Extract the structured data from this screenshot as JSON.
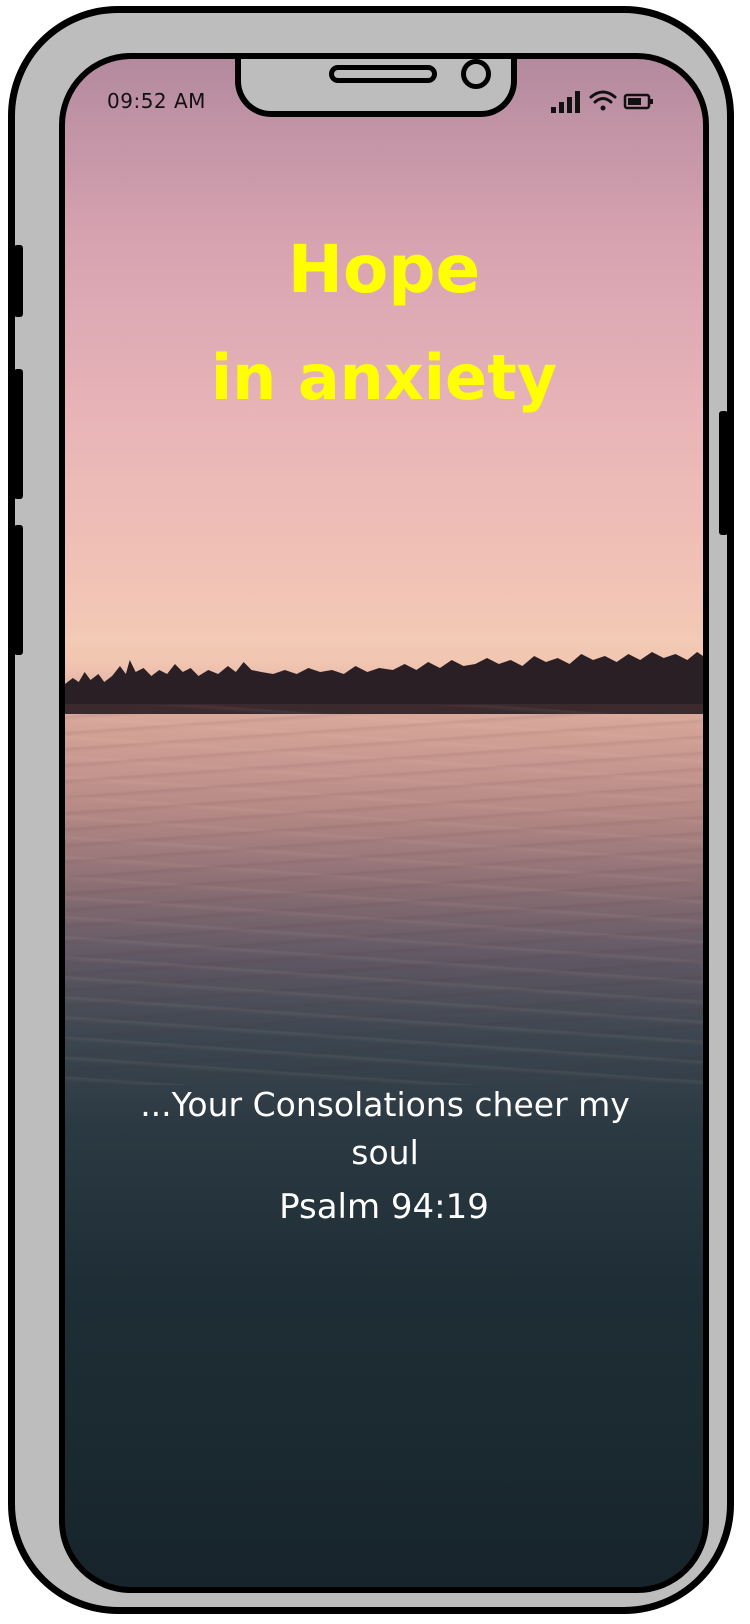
{
  "status_bar": {
    "time": "09:52 AM",
    "icons": [
      "cellular-signal-icon",
      "wifi-icon",
      "battery-icon"
    ]
  },
  "content": {
    "title_line_1": "Hope",
    "title_line_2": "in anxiety",
    "verse": "...Your Consolations cheer my soul",
    "reference": "Psalm 94:19"
  },
  "colors": {
    "title": "#ffff00",
    "body_text": "#ffffff",
    "frame": "#bdbdbd",
    "outline": "#000000"
  }
}
